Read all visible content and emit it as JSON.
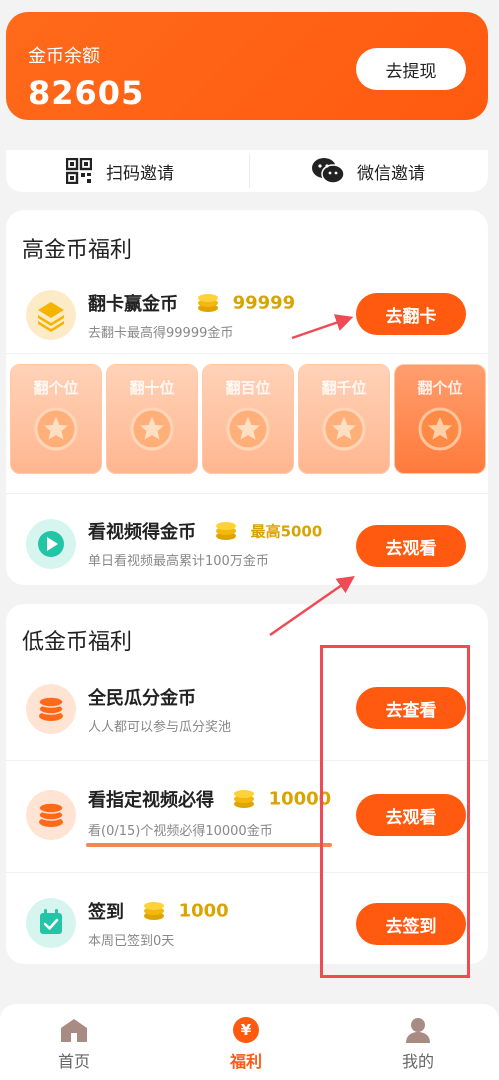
{
  "balance": {
    "label": "金币余额",
    "value": "82605",
    "withdraw_label": "去提现"
  },
  "invite": {
    "scan_label": "扫码邀请",
    "wechat_label": "微信邀请"
  },
  "high_section": {
    "title": "高金币福利",
    "flip": {
      "title": "翻卡赢金币",
      "reward": "99999",
      "subtitle": "去翻卡最高得99999金币",
      "button": "去翻卡"
    },
    "flip_cards": [
      {
        "label": "翻个位"
      },
      {
        "label": "翻十位"
      },
      {
        "label": "翻百位"
      },
      {
        "label": "翻千位"
      },
      {
        "label": "翻个位"
      }
    ],
    "video": {
      "title": "看视频得金币",
      "reward": "最高5000",
      "subtitle": "单日看视频最高累计100万金币",
      "button": "去观看"
    }
  },
  "low_section": {
    "title": "低金币福利",
    "items": [
      {
        "title": "全民瓜分金币",
        "reward": "",
        "subtitle": "人人都可以参与瓜分奖池",
        "button": "去查看"
      },
      {
        "title": "看指定视频必得",
        "reward": "10000",
        "subtitle": "看(0/15)个视频必得10000金币",
        "button": "去观看"
      },
      {
        "title": "签到",
        "reward": "1000",
        "subtitle": "本周已签到0天",
        "button": "去签到"
      }
    ]
  },
  "tabbar": {
    "tabs": [
      {
        "label": "首页"
      },
      {
        "label": "福利"
      },
      {
        "label": "我的"
      }
    ],
    "active": "福利"
  },
  "colors": {
    "accent": "#ff5a10",
    "gold": "#d9a400",
    "annotation": "#ee4b55"
  }
}
